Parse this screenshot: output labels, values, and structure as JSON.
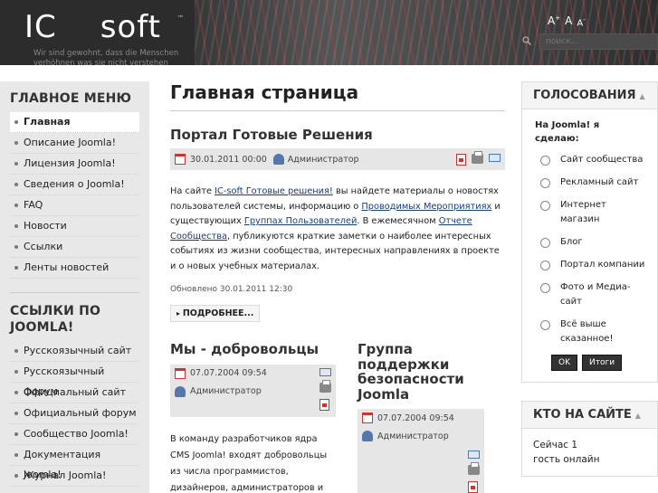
{
  "header": {
    "logo_left": "IC",
    "logo_right": "soft",
    "logo_tm": "™",
    "tagline": "Wir sind gewohnt, dass die Menschen verhöhnen was sie nicht verstehen",
    "font_bigger": "A",
    "font_bigger_sup": "+",
    "font_reset": "A",
    "font_smaller": "A",
    "font_smaller_sup": "-",
    "search_placeholder": "поиск..."
  },
  "left": {
    "main_menu_title": "ГЛАВНОЕ МЕНЮ",
    "main_menu": [
      "Главная",
      "Описание Joomla!",
      "Лицензия Joomla!",
      "Сведения о Joomla!",
      "FAQ",
      "Новости",
      "Ссылки",
      "Ленты новостей"
    ],
    "links_title_1": "ССЫЛКИ ПО",
    "links_title_2": "JOOMLA!",
    "links": [
      "Русскоязычный сайт",
      "Русскоязычный форум",
      "Официальный сайт",
      "Официальный форум",
      "Сообщество Joomla!",
      "Документация Joomla!",
      "Журнал Joomla!"
    ]
  },
  "main": {
    "page_title": "Главная страница",
    "article": {
      "title": "Портал Готовые Решения",
      "date": "30.01.2011 00:00",
      "author": "Администратор",
      "t1": "На сайте ",
      "l1": "IC-soft Готовые решения!",
      "t2": " вы найдете материалы о новостях пользователей системы, информацию о ",
      "l2": "Проводимых Мероприятиях",
      "t3": " и существующих ",
      "l3": "Группах Пользователей",
      "t4": ". В ежемесячном ",
      "l4": "Отчете Сообщества",
      "t5": ", публикуются краткие заметки о наиболее интересных событиях из жизни сообщества, интересных направлениях в проекте и о новых учебных материалах.",
      "updated": "Обновлено 30.01.2011 12:30",
      "readmore": "ПОДРОБНЕЕ..."
    },
    "col1": {
      "title": "Мы - добровольцы",
      "date": "07.07.2004 09:54",
      "author": "Администратор",
      "text": "В команду разработчиков ядра CMS Joomla! входят добровольцы из числа программистов, дизайнеров, администраторов и"
    },
    "col2": {
      "title_1": "Группа",
      "title_2": "поддержки",
      "title_3": "безопасности",
      "title_4": "Joomla",
      "date": "07.07.2004 09:54",
      "author": "Администратор"
    }
  },
  "right": {
    "poll_title": "ГОЛОСОВАНИЯ",
    "poll_question": "На Joomla! я сделаю:",
    "poll_options": [
      "Сайт сообщества",
      "Рекламный сайт",
      "Интернет магазин",
      "Блог",
      "Портал компании",
      "Фото и Медиа-сайт",
      "Всё выше сказанное!"
    ],
    "ok_label": "OK",
    "results_label": "Итоги",
    "who_title": "КТО НА САЙТЕ",
    "who_line1": "Сейчас 1",
    "who_line2": "гость онлайн"
  }
}
